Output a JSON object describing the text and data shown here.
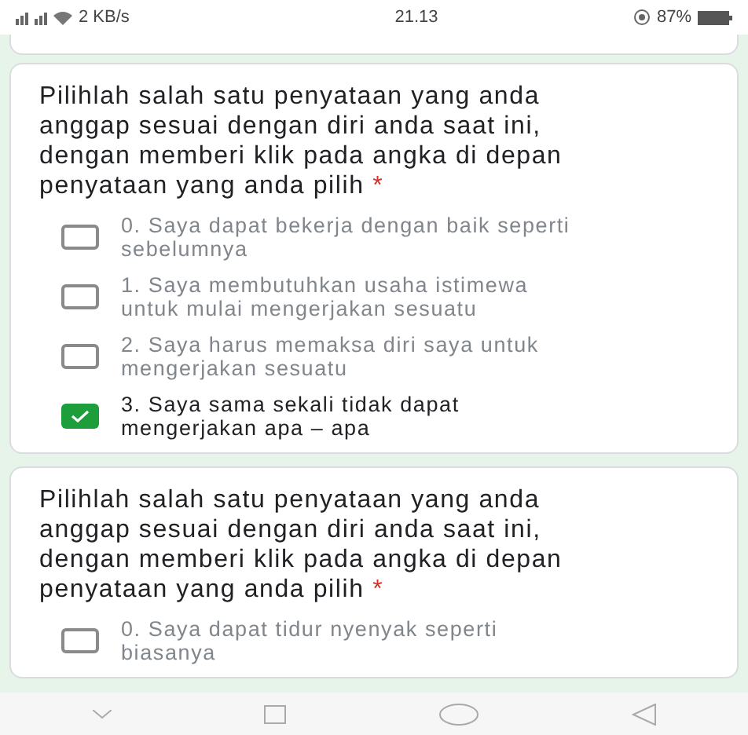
{
  "status_bar": {
    "signal": "2 KB/s",
    "time": "21.13",
    "battery": "87%"
  },
  "questions": [
    {
      "text": "Pilihlah salah satu penyataan yang anda anggap sesuai dengan diri anda saat ini, dengan memberi klik pada angka di depan penyataan yang anda pilih",
      "required_mark": "*",
      "options": [
        {
          "label": "0. Saya dapat bekerja dengan baik seperti sebelumnya",
          "checked": false
        },
        {
          "label": "1. Saya membutuhkan usaha istimewa untuk mulai mengerjakan sesuatu",
          "checked": false
        },
        {
          "label": "2. Saya harus memaksa diri saya untuk mengerjakan sesuatu",
          "checked": false
        },
        {
          "label": "3. Saya sama sekali tidak dapat mengerjakan apa – apa",
          "checked": true
        }
      ]
    },
    {
      "text": "Pilihlah salah satu penyataan yang anda anggap sesuai dengan diri anda saat ini, dengan memberi klik pada angka di depan penyataan yang anda pilih",
      "required_mark": "*",
      "options": [
        {
          "label": "0. Saya dapat tidur nyenyak seperti biasanya",
          "checked": false
        }
      ]
    }
  ]
}
